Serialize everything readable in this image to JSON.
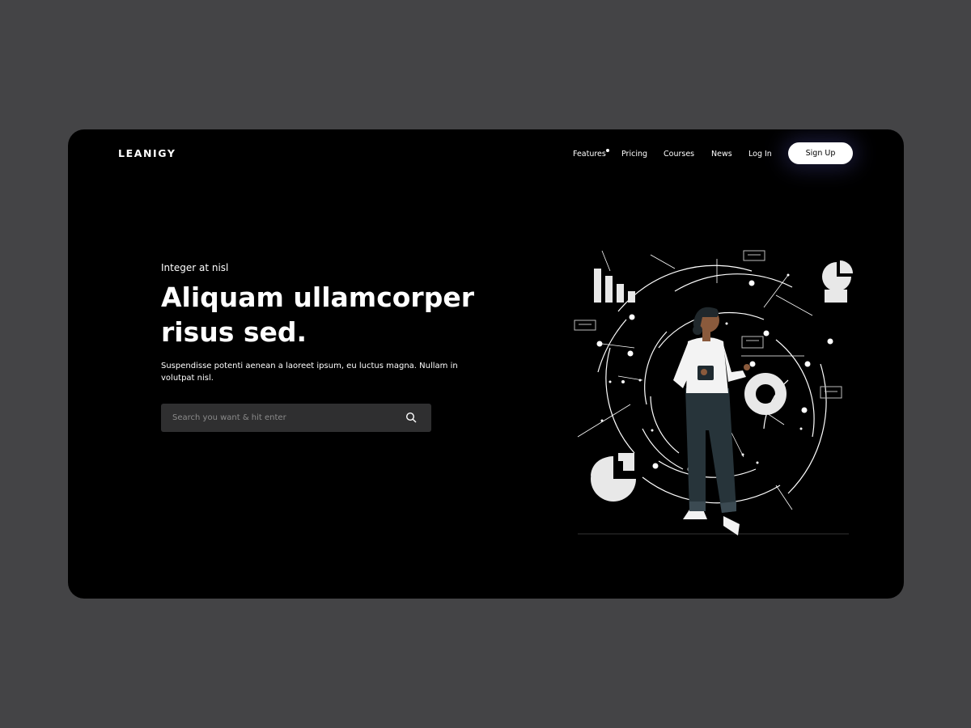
{
  "brand": {
    "logo": "LEANIGY"
  },
  "nav": {
    "items": [
      {
        "label": "Features",
        "has_indicator": true
      },
      {
        "label": "Pricing"
      },
      {
        "label": "Courses"
      },
      {
        "label": "News"
      },
      {
        "label": "Log In"
      }
    ],
    "signup_label": "Sign Up"
  },
  "hero": {
    "eyebrow": "Integer at nisl",
    "headline_line1": "Aliquam ullamcorper",
    "headline_line2": "risus sed.",
    "paragraph": "Suspendisse potenti aenean a laoreet ipsum, eu luctus magna. Nullam in volutpat nisl.",
    "search_placeholder": "Search you want & hit enter"
  },
  "icons": {
    "search": "search-icon"
  },
  "colors": {
    "page_bg": "#444446",
    "frame_bg": "#000000",
    "accent": "#ffffff",
    "search_bg": "#2f2f30"
  }
}
